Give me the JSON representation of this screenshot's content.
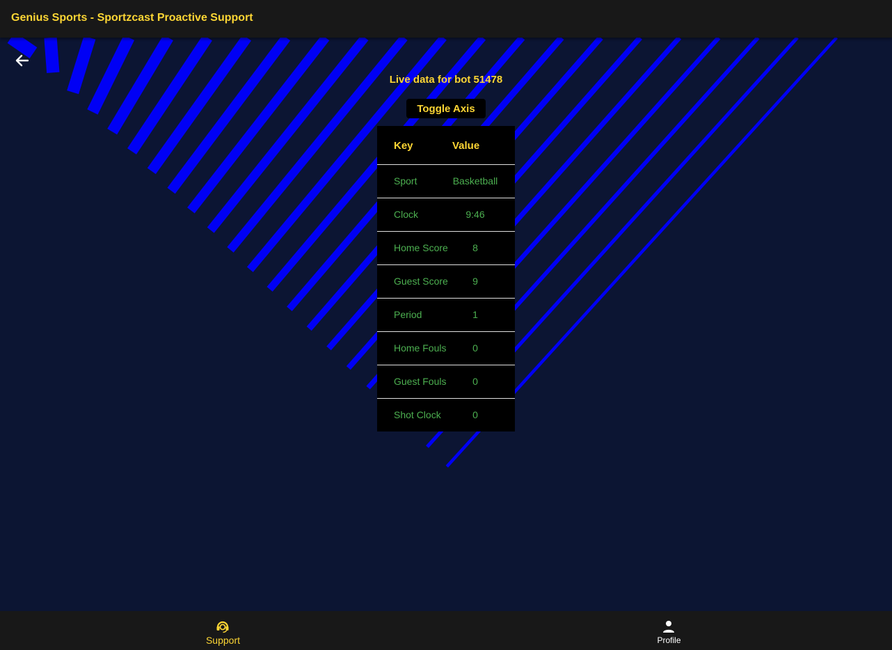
{
  "header": {
    "title": "Genius Sports - Sportzcast Proactive Support"
  },
  "main": {
    "back_icon": "arrow-left-icon",
    "live_title": "Live data for bot 51478",
    "toggle_label": "Toggle Axis",
    "table": {
      "headers": {
        "key": "Key",
        "value": "Value"
      },
      "rows": [
        {
          "key": "Sport",
          "value": "Basketball"
        },
        {
          "key": "Clock",
          "value": "9:46"
        },
        {
          "key": "Home Score",
          "value": "8"
        },
        {
          "key": "Guest Score",
          "value": "9"
        },
        {
          "key": "Period",
          "value": "1"
        },
        {
          "key": "Home Fouls",
          "value": "0"
        },
        {
          "key": "Guest Fouls",
          "value": "0"
        },
        {
          "key": "Shot Clock",
          "value": "0"
        }
      ]
    }
  },
  "bottom_nav": {
    "items": [
      {
        "label": "Support",
        "icon": "support-agent-icon",
        "active": true
      },
      {
        "label": "Profile",
        "icon": "person-icon",
        "active": false
      }
    ]
  },
  "colors": {
    "accent": "#fcd534",
    "value_green": "#4caf50",
    "stripe_blue": "#0000f5",
    "background": "#0c1533",
    "bar": "#181818"
  }
}
